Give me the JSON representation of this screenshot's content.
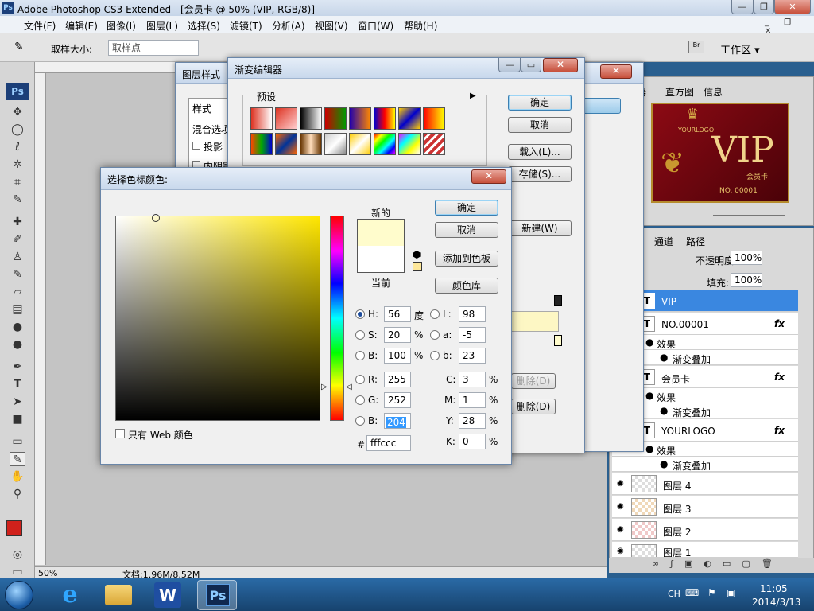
{
  "titlebar": {
    "title": "Adobe Photoshop CS3 Extended - [会员卡 @ 50% (VIP, RGB/8)]",
    "ps": "Ps"
  },
  "menu": [
    "文件(F)",
    "编辑(E)",
    "图像(I)",
    "图层(L)",
    "选择(S)",
    "滤镜(T)",
    "分析(A)",
    "视图(V)",
    "窗口(W)",
    "帮助(H)"
  ],
  "options": {
    "sample_size_label": "取样大小:",
    "sample_size_value": "取样点",
    "workspace": "工作区 ▾"
  },
  "layer_style": {
    "title": "图层样式",
    "style_header": "样式",
    "blend_options": "混合选项",
    "drop_shadow": "投影",
    "inner_shadow": "内阴影"
  },
  "gradient_editor": {
    "title": "渐变编辑器",
    "presets": "预设",
    "ok": "确定",
    "cancel": "取消",
    "load": "载入(L)...",
    "save": "存储(S)...",
    "new": "新建(W)",
    "delete1": "删除(D)",
    "delete2": "删除(D)"
  },
  "color_picker": {
    "title": "选择色标颜色:",
    "new_label": "新的",
    "current_label": "当前",
    "ok": "确定",
    "cancel": "取消",
    "add_swatch": "添加到色板",
    "libraries": "颜色库",
    "web_only": "只有 Web 颜色",
    "h": {
      "label": "H:",
      "value": "56",
      "unit": "度"
    },
    "s": {
      "label": "S:",
      "value": "20",
      "unit": "%"
    },
    "b": {
      "label": "B:",
      "value": "100",
      "unit": "%"
    },
    "r": {
      "label": "R:",
      "value": "255"
    },
    "g": {
      "label": "G:",
      "value": "252"
    },
    "bb": {
      "label": "B:",
      "value": "204"
    },
    "l": {
      "label": "L:",
      "value": "98"
    },
    "a": {
      "label": "a:",
      "value": "-5"
    },
    "lab_b": {
      "label": "b:",
      "value": "23"
    },
    "c": {
      "label": "C:",
      "value": "3",
      "unit": "%"
    },
    "m": {
      "label": "M:",
      "value": "1",
      "unit": "%"
    },
    "y": {
      "label": "Y:",
      "value": "28",
      "unit": "%"
    },
    "k": {
      "label": "K:",
      "value": "0",
      "unit": "%"
    },
    "hex_label": "#",
    "hex": "fffccc",
    "new_color": "#fffccc",
    "current_color": "#ffffff"
  },
  "navigator": {
    "tab1": "器",
    "tab2": "直方图",
    "tab3": "信息",
    "vip": "VIP",
    "yourlogo": "YOURLOGO",
    "card": "会员卡",
    "no": "NO. 00001"
  },
  "layers_panel": {
    "tab_channels": "通道",
    "tab_paths": "路径",
    "opacity_label": "不透明度:",
    "opacity": "100%",
    "fill_label": "填充:",
    "fill": "100%",
    "effects": "效果",
    "gradient_overlay": "渐变叠加",
    "fx": "fx",
    "layers": [
      "VIP",
      "NO.00001",
      "会员卡",
      "YOURLOGO",
      "图层 4",
      "图层 3",
      "图层 2",
      "图层 1"
    ]
  },
  "status": {
    "zoom": "50%",
    "doc": "文档:1.96M/8.52M"
  },
  "taskbar": {
    "lang": "CH",
    "time": "11:05",
    "date": "2014/3/13"
  }
}
